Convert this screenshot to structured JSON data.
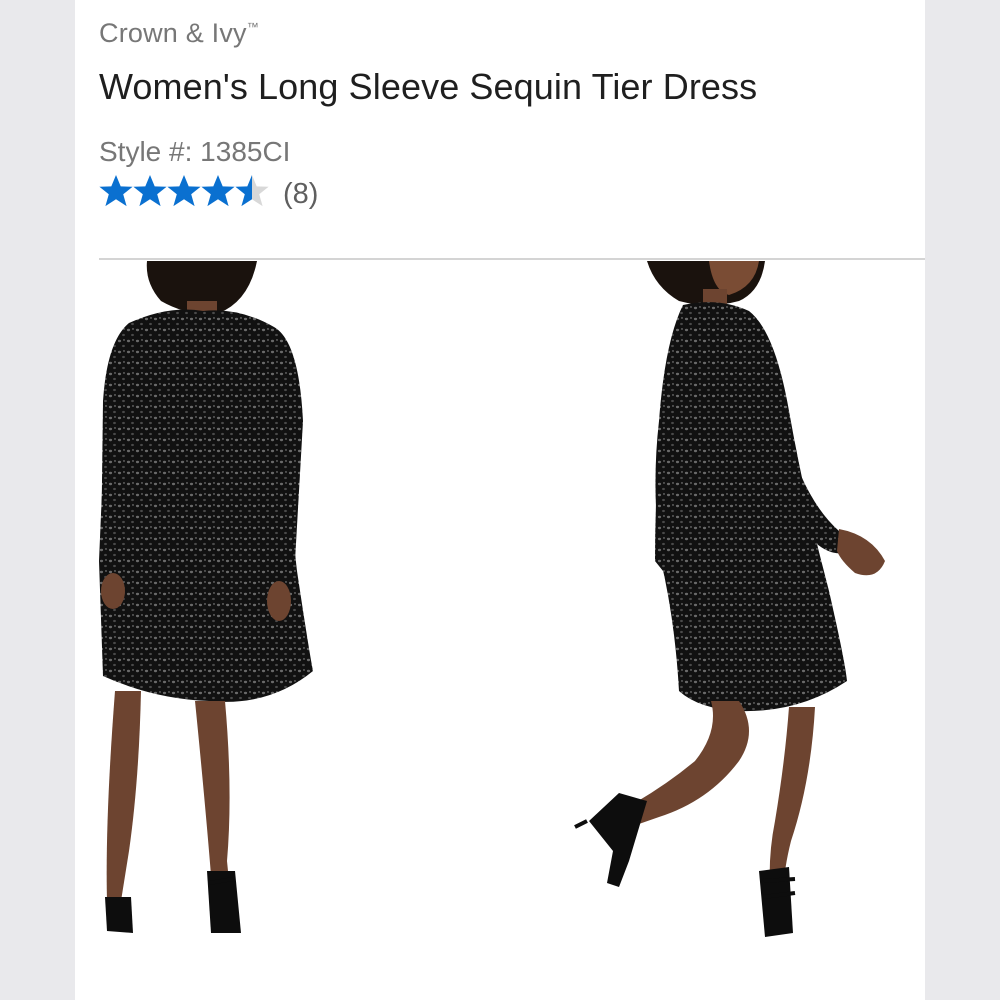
{
  "product": {
    "brand": "Crown & Ivy",
    "brand_mark": "™",
    "title": "Women's Long Sleeve Sequin Tier Dress",
    "style_label": "Style #: ",
    "style_number": "1385CI",
    "rating": {
      "value": 4.5,
      "max": 5,
      "review_count_text": "(8)"
    }
  },
  "colors": {
    "star_filled": "#0a70d0",
    "star_empty": "#d8d8d8",
    "brand_text": "#777777",
    "title_text": "#1f1f1f"
  },
  "gallery": {
    "images": [
      {
        "name": "back-view-photo",
        "dress_color": "black sequin"
      },
      {
        "name": "side-view-photo",
        "dress_color": "black sequin"
      }
    ]
  }
}
